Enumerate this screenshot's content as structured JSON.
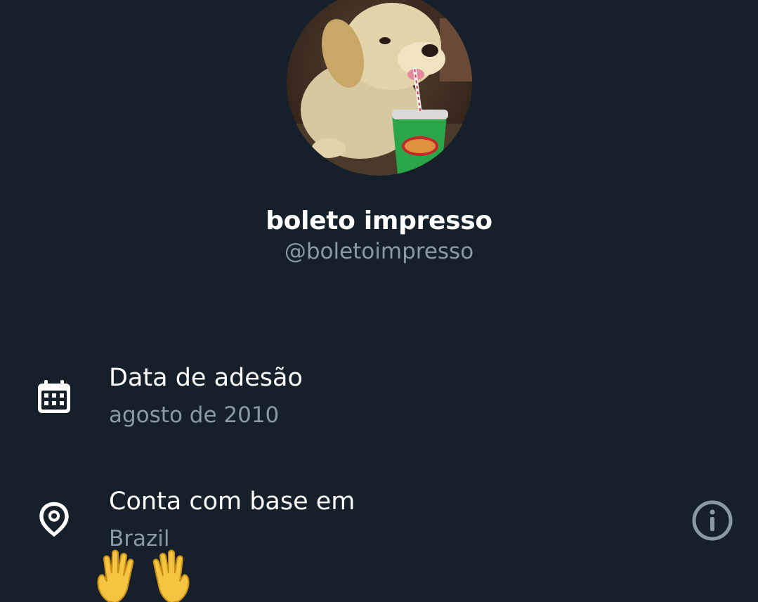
{
  "profile": {
    "display_name": "boleto impresso",
    "handle": "@boletoimpresso"
  },
  "about": {
    "joined": {
      "title": "Data de adesão",
      "value": "agosto de 2010",
      "icon": "calendar-icon"
    },
    "location": {
      "title": "Conta com base em",
      "value": "Brazil",
      "icon": "location-pin-icon",
      "extra_icon": "info-icon"
    }
  },
  "emoji": {
    "name": "raised-hands-emoji"
  },
  "colors": {
    "background": "#15202b",
    "primary_text": "#ffffff",
    "secondary_text": "#8b98a5"
  }
}
